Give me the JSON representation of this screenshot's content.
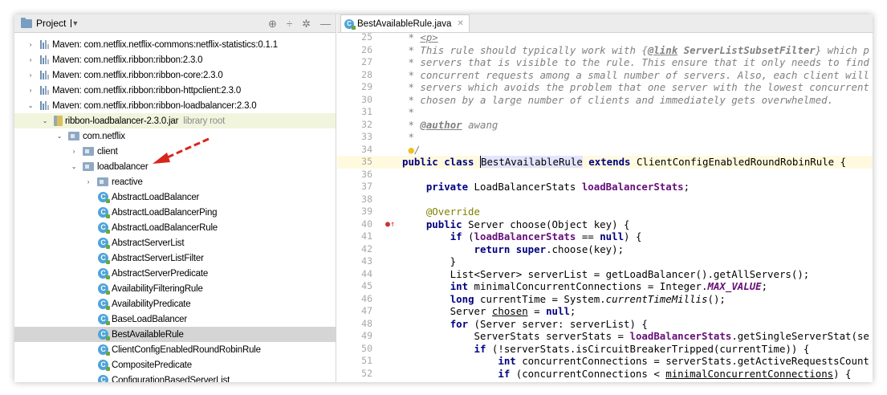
{
  "project_panel": {
    "title": "Project",
    "tree": [
      {
        "depth": 0,
        "arrow": "›",
        "icon": "lib",
        "label": "Maven: com.netflix.netflix-commons:netflix-statistics:0.1.1"
      },
      {
        "depth": 0,
        "arrow": "›",
        "icon": "lib",
        "label": "Maven: com.netflix.ribbon:ribbon:2.3.0"
      },
      {
        "depth": 0,
        "arrow": "›",
        "icon": "lib",
        "label": "Maven: com.netflix.ribbon:ribbon-core:2.3.0"
      },
      {
        "depth": 0,
        "arrow": "›",
        "icon": "lib",
        "label": "Maven: com.netflix.ribbon:ribbon-httpclient:2.3.0"
      },
      {
        "depth": 0,
        "arrow": "⌄",
        "icon": "lib",
        "label": "Maven: com.netflix.ribbon:ribbon-loadbalancer:2.3.0"
      },
      {
        "depth": 1,
        "arrow": "⌄",
        "icon": "jar",
        "label": "ribbon-loadbalancer-2.3.0.jar",
        "suffix": "library root",
        "highlight": true
      },
      {
        "depth": 2,
        "arrow": "⌄",
        "icon": "pkg",
        "label": "com.netflix"
      },
      {
        "depth": 3,
        "arrow": "›",
        "icon": "pkg",
        "label": "client"
      },
      {
        "depth": 3,
        "arrow": "⌄",
        "icon": "pkg",
        "label": "loadbalancer"
      },
      {
        "depth": 4,
        "arrow": "›",
        "icon": "pkg",
        "label": "reactive"
      },
      {
        "depth": 5,
        "arrow": "",
        "icon": "class",
        "label": "AbstractLoadBalancer"
      },
      {
        "depth": 5,
        "arrow": "",
        "icon": "class",
        "label": "AbstractLoadBalancerPing"
      },
      {
        "depth": 5,
        "arrow": "",
        "icon": "class",
        "label": "AbstractLoadBalancerRule"
      },
      {
        "depth": 5,
        "arrow": "",
        "icon": "class",
        "label": "AbstractServerList"
      },
      {
        "depth": 5,
        "arrow": "",
        "icon": "class",
        "label": "AbstractServerListFilter"
      },
      {
        "depth": 5,
        "arrow": "",
        "icon": "class",
        "label": "AbstractServerPredicate"
      },
      {
        "depth": 5,
        "arrow": "",
        "icon": "class",
        "label": "AvailabilityFilteringRule"
      },
      {
        "depth": 5,
        "arrow": "",
        "icon": "class",
        "label": "AvailabilityPredicate"
      },
      {
        "depth": 5,
        "arrow": "",
        "icon": "class",
        "label": "BaseLoadBalancer"
      },
      {
        "depth": 5,
        "arrow": "",
        "icon": "class",
        "label": "BestAvailableRule",
        "selected": true
      },
      {
        "depth": 5,
        "arrow": "",
        "icon": "class",
        "label": "ClientConfigEnabledRoundRobinRule"
      },
      {
        "depth": 5,
        "arrow": "",
        "icon": "class",
        "label": "CompositePredicate"
      },
      {
        "depth": 5,
        "arrow": "",
        "icon": "class",
        "label": "ConfigurationBasedServerList"
      }
    ]
  },
  "editor": {
    "tab_label": "BestAvailableRule.java",
    "lines": [
      {
        "n": "25",
        "html": "<span class=\"cm\"> * </span><span class=\"tag\">&lt;p&gt;</span>"
      },
      {
        "n": "26",
        "html": "<span class=\"cm\"> * This rule should typically work with {</span><span class=\"cmb\">@link</span><span class=\"cm\" style=\"font-weight:bold\"> ServerListSubsetFilter</span><span class=\"cm\">} which p</span>"
      },
      {
        "n": "27",
        "html": "<span class=\"cm\"> * servers that is visible to the rule. This ensure that it only needs to find</span>"
      },
      {
        "n": "28",
        "html": "<span class=\"cm\"> * concurrent requests among a small number of servers. Also, each client will</span>"
      },
      {
        "n": "29",
        "html": "<span class=\"cm\"> * servers which avoids the problem that one server with the lowest concurrent</span>"
      },
      {
        "n": "30",
        "html": "<span class=\"cm\"> * chosen by a large number of clients and immediately gets overwhelmed.</span>"
      },
      {
        "n": "31",
        "html": "<span class=\"cm\"> *</span>"
      },
      {
        "n": "32",
        "html": "<span class=\"cm\"> * </span><span class=\"cmb\">@author</span><span class=\"cm\"> awang</span>"
      },
      {
        "n": "33",
        "html": "<span class=\"cm\"> *</span>"
      },
      {
        "n": "34",
        "html": "<span class=\"cm\"> </span><span class=\"bulb\">●</span><span class=\"cm\">/</span>"
      },
      {
        "n": "35",
        "active": true,
        "html": "<span class=\"kw\">public class </span><span class=\"caret\"></span><span class=\"hlname\">BestAvailableRule</span> <span class=\"kw\">extends</span> ClientConfigEnabledRoundRobinRule {"
      },
      {
        "n": "36",
        "html": ""
      },
      {
        "n": "37",
        "html": "    <span class=\"kw\">private</span> LoadBalancerStats <span class=\"fld\">loadBalancerStats</span>;"
      },
      {
        "n": "38",
        "html": ""
      },
      {
        "n": "39",
        "html": "    <span class=\"ann\">@Override</span>"
      },
      {
        "n": "40",
        "mark": true,
        "html": "    <span class=\"kw\">public</span> Server choose(Object key) {"
      },
      {
        "n": "41",
        "html": "        <span class=\"kw\">if</span> (<span class=\"fld\">loadBalancerStats</span> == <span class=\"kw\">null</span>) {"
      },
      {
        "n": "42",
        "html": "            <span class=\"kw\">return super</span>.choose(key);"
      },
      {
        "n": "43",
        "html": "        }"
      },
      {
        "n": "44",
        "html": "        List&lt;Server&gt; serverList = getLoadBalancer().getAllServers();"
      },
      {
        "n": "45",
        "html": "        <span class=\"kw\">int</span> minimalConcurrentConnections = Integer.<span class=\"stat\">MAX_VALUE</span>;"
      },
      {
        "n": "46",
        "html": "        <span class=\"kw\">long</span> currentTime = System.<span class=\"ital\">currentTimeMillis</span>();"
      },
      {
        "n": "47",
        "html": "        Server <span class=\"ul\">chosen</span> = <span class=\"kw\">null</span>;"
      },
      {
        "n": "48",
        "html": "        <span class=\"kw\">for</span> (Server server: serverList) {"
      },
      {
        "n": "49",
        "html": "            ServerStats serverStats = <span class=\"fld\">loadBalancerStats</span>.getSingleServerStat(se"
      },
      {
        "n": "50",
        "html": "            <span class=\"kw\">if</span> (!serverStats.isCircuitBreakerTripped(currentTime)) {"
      },
      {
        "n": "51",
        "html": "                <span class=\"kw\">int</span> concurrentConnections = serverStats.getActiveRequestsCount"
      },
      {
        "n": "52",
        "html": "                <span class=\"kw\">if</span> (concurrentConnections &lt; <span class=\"ul\">minimalConcurrentConnections</span>) {"
      }
    ]
  }
}
